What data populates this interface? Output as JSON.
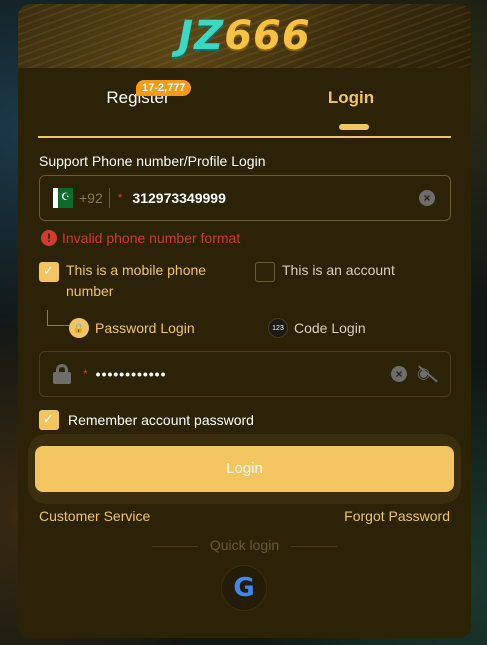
{
  "logo": {
    "part1": "JZ",
    "part2": "666"
  },
  "tabs": {
    "register": "Register",
    "register_badge": "17-2,777",
    "login": "Login"
  },
  "form": {
    "section_label": "Support Phone number/Profile Login",
    "country_code": "+92",
    "phone_value": "312973349999",
    "error_text": "Invalid phone number format",
    "option_mobile": "This is a mobile phone number",
    "option_account": "This is an account",
    "mode_password": "Password Login",
    "mode_code": "Code Login",
    "mode_code_icon": "123",
    "password_value": "••••••••••••",
    "remember": "Remember account password",
    "login_button": "Login"
  },
  "links": {
    "customer_service": "Customer Service",
    "forgot_password": "Forgot Password"
  },
  "quick_login": {
    "label": "Quick login",
    "google_icon": "G"
  },
  "colors": {
    "accent": "#f2c561",
    "error": "#d23c2c",
    "panel": "#2b2208"
  }
}
